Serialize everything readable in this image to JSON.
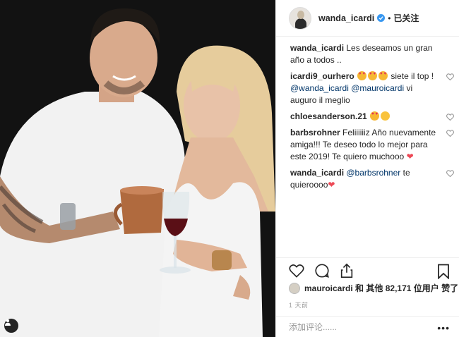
{
  "header": {
    "username": "wanda_icardi",
    "separator": "•",
    "follow_status": "已关注"
  },
  "comments": [
    {
      "user": "wanda_icardi",
      "text": "Les deseamos un gran año a todos .."
    },
    {
      "user": "icardi9_ourhero",
      "text": "siete il top !",
      "mentions": [
        "@wanda_icardi",
        "@mauroicardi"
      ],
      "tail": "vi auguro il meglio"
    },
    {
      "user": "chloesanderson.21",
      "text": ""
    },
    {
      "user": "barbsrohner",
      "text": "Feliiiiiiz Año nuevamente amiga!!! Te deseo todo lo mejor para este 2019! Te quiero muchooo"
    },
    {
      "user": "wanda_icardi",
      "mention": "@barbsrohner",
      "text": "te quieroooo"
    }
  ],
  "likes": {
    "user": "mauroicardi",
    "text": "和 其他 82,171 位用户 赞了"
  },
  "timestamp": "1 天前",
  "add_comment": {
    "placeholder": "添加评论......"
  },
  "more_label": "•••",
  "colors": {
    "link": "#003569",
    "verified": "#3897f0",
    "heart": "#ed4956",
    "border": "#efefef"
  }
}
